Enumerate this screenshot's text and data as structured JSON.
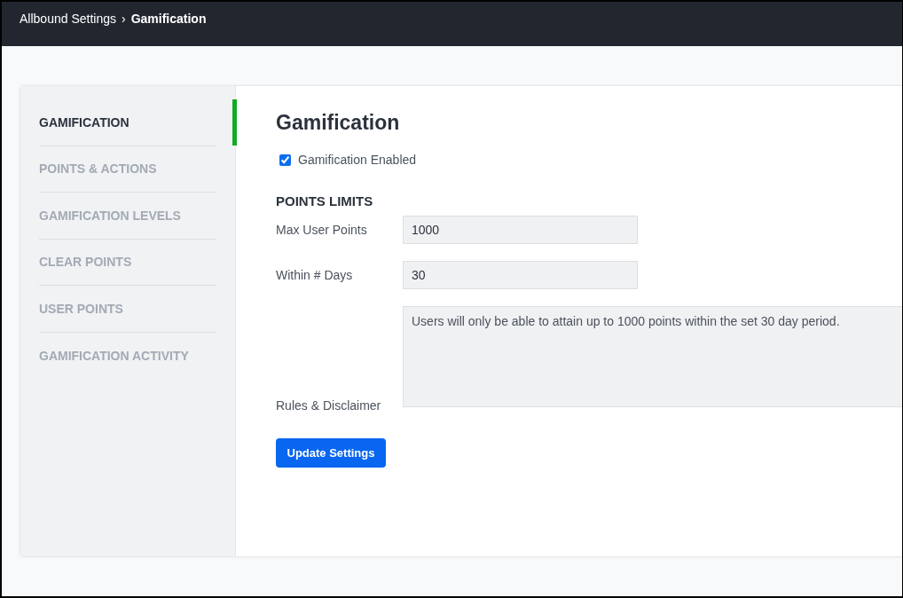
{
  "breadcrumb": {
    "parent": "Allbound Settings",
    "separator": "›",
    "current": "Gamification"
  },
  "sidebar": {
    "items": [
      {
        "label": "GAMIFICATION",
        "selected": true
      },
      {
        "label": "POINTS & ACTIONS",
        "selected": false
      },
      {
        "label": "GAMIFICATION LEVELS",
        "selected": false
      },
      {
        "label": "CLEAR POINTS",
        "selected": false
      },
      {
        "label": "USER POINTS",
        "selected": false
      },
      {
        "label": "GAMIFICATION ACTIVITY",
        "selected": false
      }
    ]
  },
  "main": {
    "title": "Gamification",
    "checkbox": {
      "label": "Gamification Enabled",
      "checked": true
    },
    "section_title": "POINTS LIMITS",
    "fields": [
      {
        "kind": "input",
        "label": "Max User Points",
        "value": "1000"
      },
      {
        "kind": "input",
        "label": "Within # Days",
        "value": "30"
      },
      {
        "kind": "textarea",
        "label": "Rules & Disclaimer",
        "value": "Users will only be able to attain up to 1000 points within the set 30 day period."
      }
    ],
    "button": "Update Settings"
  }
}
